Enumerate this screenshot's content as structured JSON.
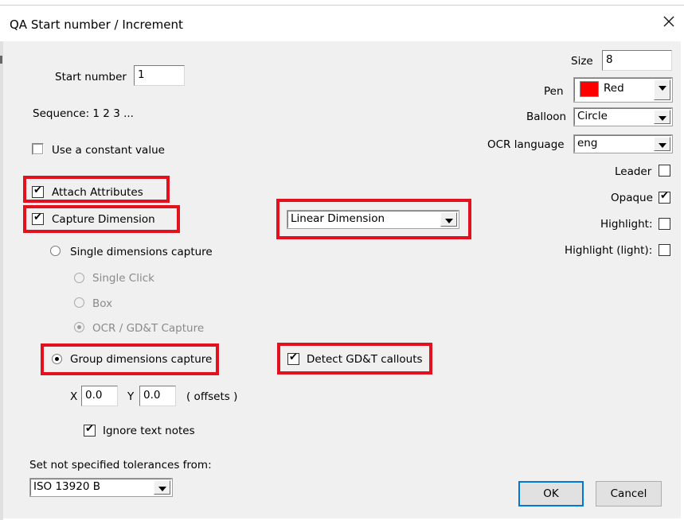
{
  "window": {
    "title": "QA Start number / Increment"
  },
  "start_number": {
    "label": "Start number",
    "value": "1"
  },
  "sequence": {
    "text": "Sequence:  1 2 3 ..."
  },
  "constant": {
    "label": "Use a constant value",
    "checked": false
  },
  "attach_attributes": {
    "label": "Attach Attributes",
    "checked": true
  },
  "capture_dimension": {
    "label": "Capture Dimension",
    "checked": true
  },
  "dimension_type": {
    "value": "Linear Dimension"
  },
  "single_capture": {
    "label": "Single dimensions capture",
    "selected": false
  },
  "single_options": [
    {
      "label": "Single Click",
      "selected": false
    },
    {
      "label": "Box",
      "selected": false
    },
    {
      "label": "OCR / GD&T Capture",
      "selected": true
    }
  ],
  "group_capture": {
    "label": "Group dimensions capture",
    "selected": true
  },
  "detect_gdt": {
    "label": "Detect GD&T callouts",
    "checked": true
  },
  "offsets": {
    "x_label": "X",
    "x_value": "0.0",
    "y_label": "Y",
    "y_value": "0.0",
    "suffix": "( offsets )"
  },
  "ignore_notes": {
    "label": "Ignore text notes",
    "checked": true
  },
  "tolerances": {
    "label": "Set not specified tolerances from:",
    "value": "ISO 13920 B"
  },
  "size": {
    "label": "Size",
    "value": "8"
  },
  "pen": {
    "label": "Pen",
    "value": "Red",
    "color": "#ff0000"
  },
  "balloon": {
    "label": "Balloon",
    "value": "Circle"
  },
  "ocr_language": {
    "label": "OCR language",
    "value": "eng"
  },
  "leader": {
    "label": "Leader",
    "checked": false
  },
  "opaque": {
    "label": "Opaque",
    "checked": true
  },
  "highlight": {
    "label": "Highlight:",
    "checked": false
  },
  "highlight_light": {
    "label": "Highlight (light):",
    "checked": false
  },
  "buttons": {
    "ok": "OK",
    "cancel": "Cancel"
  },
  "annotation_color": "#e3101e"
}
